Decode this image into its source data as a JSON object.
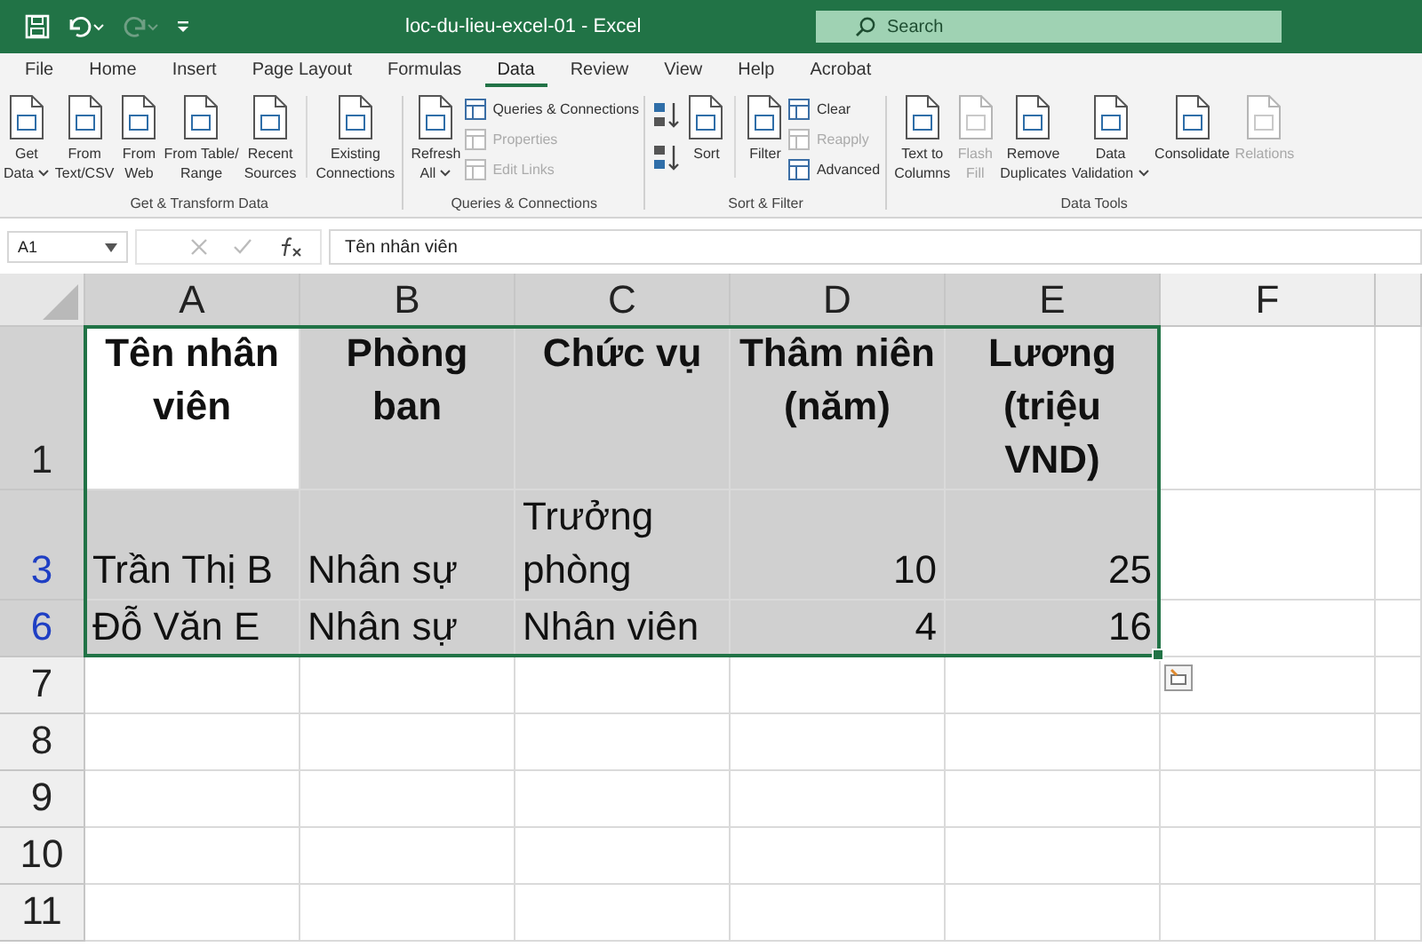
{
  "title_bar": {
    "title": "loc-du-lieu-excel-01  -  Excel",
    "search": {
      "placeholder": "Search"
    },
    "redo_disabled": true
  },
  "tabs": [
    {
      "label": "File",
      "selected": false
    },
    {
      "label": "Home",
      "selected": false
    },
    {
      "label": "Insert",
      "selected": false
    },
    {
      "label": "Page Layout",
      "selected": false
    },
    {
      "label": "Formulas",
      "selected": false
    },
    {
      "label": "Data",
      "selected": true
    },
    {
      "label": "Review",
      "selected": false
    },
    {
      "label": "View",
      "selected": false
    },
    {
      "label": "Help",
      "selected": false
    },
    {
      "label": "Acrobat",
      "selected": false
    }
  ],
  "ribbon": [
    {
      "label": "Get & Transform Data",
      "buttons": [
        {
          "kind": "large",
          "lines": [
            "Get",
            "Data"
          ],
          "dropdown": true,
          "disabled": false
        },
        {
          "kind": "large",
          "lines": [
            "From",
            "Text/CSV"
          ],
          "dropdown": false,
          "disabled": false
        },
        {
          "kind": "large",
          "lines": [
            "From",
            "Web"
          ],
          "dropdown": false,
          "disabled": false
        },
        {
          "kind": "large",
          "lines": [
            "From Table/",
            "Range"
          ],
          "dropdown": false,
          "disabled": false
        },
        {
          "kind": "large",
          "lines": [
            "Recent",
            "Sources"
          ],
          "dropdown": false,
          "disabled": false
        },
        {
          "kind": "separator"
        },
        {
          "kind": "large",
          "lines": [
            "Existing",
            "Connections"
          ],
          "dropdown": false,
          "disabled": false
        }
      ]
    },
    {
      "label": "Queries & Connections",
      "buttons": [
        {
          "kind": "large",
          "lines": [
            "Refresh",
            "All"
          ],
          "dropdown": true,
          "disabled": false
        },
        {
          "kind": "stack",
          "items": [
            {
              "label": "Queries & Connections",
              "disabled": false
            },
            {
              "label": "Properties",
              "disabled": true
            },
            {
              "label": "Edit Links",
              "disabled": true
            }
          ]
        }
      ]
    },
    {
      "label": "Sort & Filter",
      "buttons": [
        {
          "kind": "sortpair"
        },
        {
          "kind": "large",
          "lines": [
            "Sort"
          ],
          "dropdown": false,
          "disabled": false
        },
        {
          "kind": "separator"
        },
        {
          "kind": "large",
          "lines": [
            "Filter"
          ],
          "dropdown": false,
          "disabled": false
        },
        {
          "kind": "stack",
          "items": [
            {
              "label": "Clear",
              "disabled": false
            },
            {
              "label": "Reapply",
              "disabled": true
            },
            {
              "label": "Advanced",
              "disabled": false
            }
          ]
        }
      ]
    },
    {
      "label": "Data Tools",
      "buttons": [
        {
          "kind": "large",
          "lines": [
            "Text to",
            "Columns"
          ],
          "dropdown": false,
          "disabled": false
        },
        {
          "kind": "large",
          "lines": [
            "Flash",
            "Fill"
          ],
          "dropdown": false,
          "disabled": true
        },
        {
          "kind": "large",
          "lines": [
            "Remove",
            "Duplicates"
          ],
          "dropdown": false,
          "disabled": false
        },
        {
          "kind": "large",
          "lines": [
            "Data",
            "Validation"
          ],
          "dropdown": true,
          "disabled": false
        },
        {
          "kind": "large",
          "lines": [
            "Consolidate"
          ],
          "dropdown": false,
          "disabled": false
        },
        {
          "kind": "large",
          "lines": [
            "Relations"
          ],
          "dropdown": false,
          "disabled": true
        }
      ]
    }
  ],
  "formula_bar": {
    "name_box": "A1",
    "value": "Tên nhân viên"
  },
  "columns": [
    {
      "letter": "A",
      "selected": true
    },
    {
      "letter": "B",
      "selected": true
    },
    {
      "letter": "C",
      "selected": true
    },
    {
      "letter": "D",
      "selected": true
    },
    {
      "letter": "E",
      "selected": true
    },
    {
      "letter": "F",
      "selected": false
    }
  ],
  "rows": [
    {
      "number": "1",
      "filtered": false,
      "selected": true,
      "cells": [
        {
          "text": "Tên nhân viên",
          "kind": "header",
          "active": true
        },
        {
          "text": "Phòng ban",
          "kind": "header",
          "active": false
        },
        {
          "text": "Chức vụ",
          "kind": "header",
          "active": false
        },
        {
          "text": "Thâm niên (năm)",
          "kind": "header",
          "active": false
        },
        {
          "text": "Lương (triệu VND)",
          "kind": "header",
          "active": false
        }
      ]
    },
    {
      "number": "3",
      "filtered": true,
      "selected": true,
      "cells": [
        {
          "text": "Trần Thị B",
          "kind": "text",
          "active": false
        },
        {
          "text": "Nhân sự",
          "kind": "text",
          "active": false
        },
        {
          "text": "Trưởng phòng",
          "kind": "text",
          "active": false
        },
        {
          "text": "10",
          "kind": "number",
          "active": false
        },
        {
          "text": "25",
          "kind": "number",
          "active": false
        }
      ]
    },
    {
      "number": "6",
      "filtered": true,
      "selected": true,
      "cells": [
        {
          "text": "Đỗ Văn E",
          "kind": "text",
          "active": false
        },
        {
          "text": "Nhân sự",
          "kind": "text",
          "active": false
        },
        {
          "text": "Nhân viên",
          "kind": "text",
          "active": false
        },
        {
          "text": "4",
          "kind": "number",
          "active": false
        },
        {
          "text": "16",
          "kind": "number",
          "active": false
        }
      ]
    },
    {
      "number": "7",
      "filtered": false,
      "selected": false,
      "cells": []
    },
    {
      "number": "8",
      "filtered": false,
      "selected": false,
      "cells": []
    },
    {
      "number": "9",
      "filtered": false,
      "selected": false,
      "cells": []
    },
    {
      "number": "10",
      "filtered": false,
      "selected": false,
      "cells": []
    },
    {
      "number": "11",
      "filtered": false,
      "selected": false,
      "cells": []
    }
  ]
}
